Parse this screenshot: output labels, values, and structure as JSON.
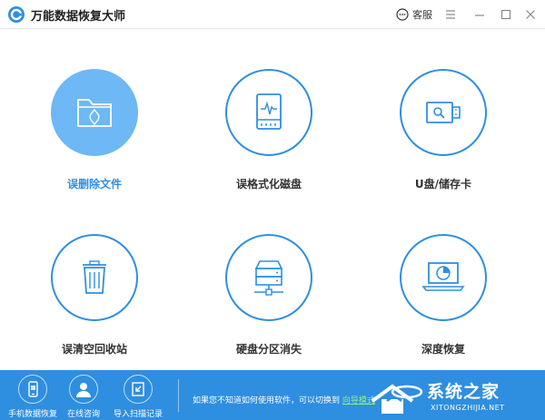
{
  "app": {
    "title": "万能数据恢复大师"
  },
  "titlebar": {
    "service_label": "客服"
  },
  "colors": {
    "accent": "#2f8fe0",
    "active_fill": "#6db8f5",
    "bottom_bar": "#2e8ee0",
    "link": "#8ef08e"
  },
  "tiles": [
    {
      "label": "误删除文件",
      "icon": "folder-recycle-icon",
      "active": true
    },
    {
      "label": "误格式化磁盘",
      "icon": "hard-disk-icon",
      "active": false
    },
    {
      "label": "U盘/储存卡",
      "icon": "usb-drive-icon",
      "active": false
    },
    {
      "label": "误清空回收站",
      "icon": "trash-bin-icon",
      "active": false
    },
    {
      "label": "硬盘分区消失",
      "icon": "network-drive-icon",
      "active": false
    },
    {
      "label": "深度恢复",
      "icon": "laptop-chart-icon",
      "active": false
    }
  ],
  "bottom": {
    "items": [
      {
        "label": "手机数据恢复",
        "icon": "phone-icon"
      },
      {
        "label": "在线咨询",
        "icon": "user-icon"
      },
      {
        "label": "导入扫描记录",
        "icon": "import-icon"
      }
    ],
    "hint_text": "如果您不知道如何使用软件，可以切换到",
    "hint_link": "向导模式"
  },
  "watermark": {
    "text": "系统之家",
    "url": "XITONGZHIJIA.NET"
  }
}
